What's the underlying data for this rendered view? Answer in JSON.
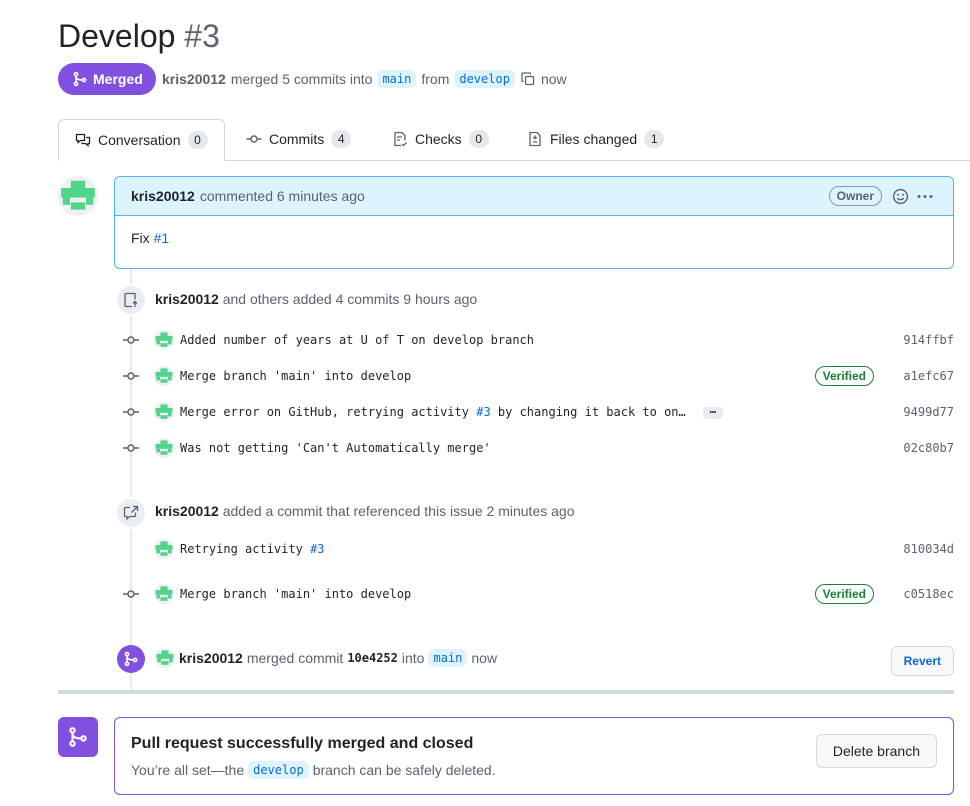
{
  "pr": {
    "title": "Develop",
    "number": "#3"
  },
  "state": {
    "label": "Merged",
    "icon": "git-merge-icon",
    "color": "#8250df"
  },
  "meta": {
    "author": "kris20012",
    "text_1": "merged 5 commits into",
    "base_branch": "main",
    "text_2": "from",
    "head_branch": "develop",
    "time": "now"
  },
  "tabs": [
    {
      "label": "Conversation",
      "count": "0",
      "icon": "comment-discussion-icon"
    },
    {
      "label": "Commits",
      "count": "4",
      "icon": "git-commit-icon"
    },
    {
      "label": "Checks",
      "count": "0",
      "icon": "checklist-icon"
    },
    {
      "label": "Files changed",
      "count": "1",
      "icon": "file-diff-icon"
    }
  ],
  "comment": {
    "author": "kris20012",
    "action": "commented 6 minutes ago",
    "role": "Owner",
    "body_text": "Fix",
    "body_link": "#1"
  },
  "event1": {
    "author": "kris20012",
    "text": "and others added 4 commits 9 hours ago",
    "commits": [
      {
        "message": "Added number of years at U of T on develop branch",
        "sha": "914ffbf"
      },
      {
        "message": "Merge branch 'main' into develop",
        "sha": "a1efc67",
        "verified": "Verified"
      },
      {
        "message_pre": "Merge error on GitHub, retrying activity",
        "message_link": "#3",
        "message_post": "by changing it back to on…",
        "more": "…",
        "sha": "9499d77"
      },
      {
        "message": "Was not getting 'Can't Automatically merge'",
        "sha": "02c80b7"
      }
    ]
  },
  "event2": {
    "author": "kris20012",
    "text": "added a commit that referenced this issue 2 minutes ago",
    "commits": [
      {
        "message_pre": "Retrying activity",
        "message_link": "#3",
        "sha": "810034d"
      },
      {
        "message": "Merge branch 'main' into develop",
        "sha": "c0518ec",
        "verified": "Verified"
      }
    ]
  },
  "merge_event": {
    "author": "kris20012",
    "text_1": "merged commit",
    "commit": "10e4252",
    "text_2": "into",
    "branch": "main",
    "time": "now",
    "revert": "Revert"
  },
  "merged_box": {
    "title": "Pull request successfully merged and closed",
    "sub_1": "You’re all set—the",
    "branch": "develop",
    "sub_2": "branch can be safely deleted.",
    "delete_label": "Delete branch"
  }
}
